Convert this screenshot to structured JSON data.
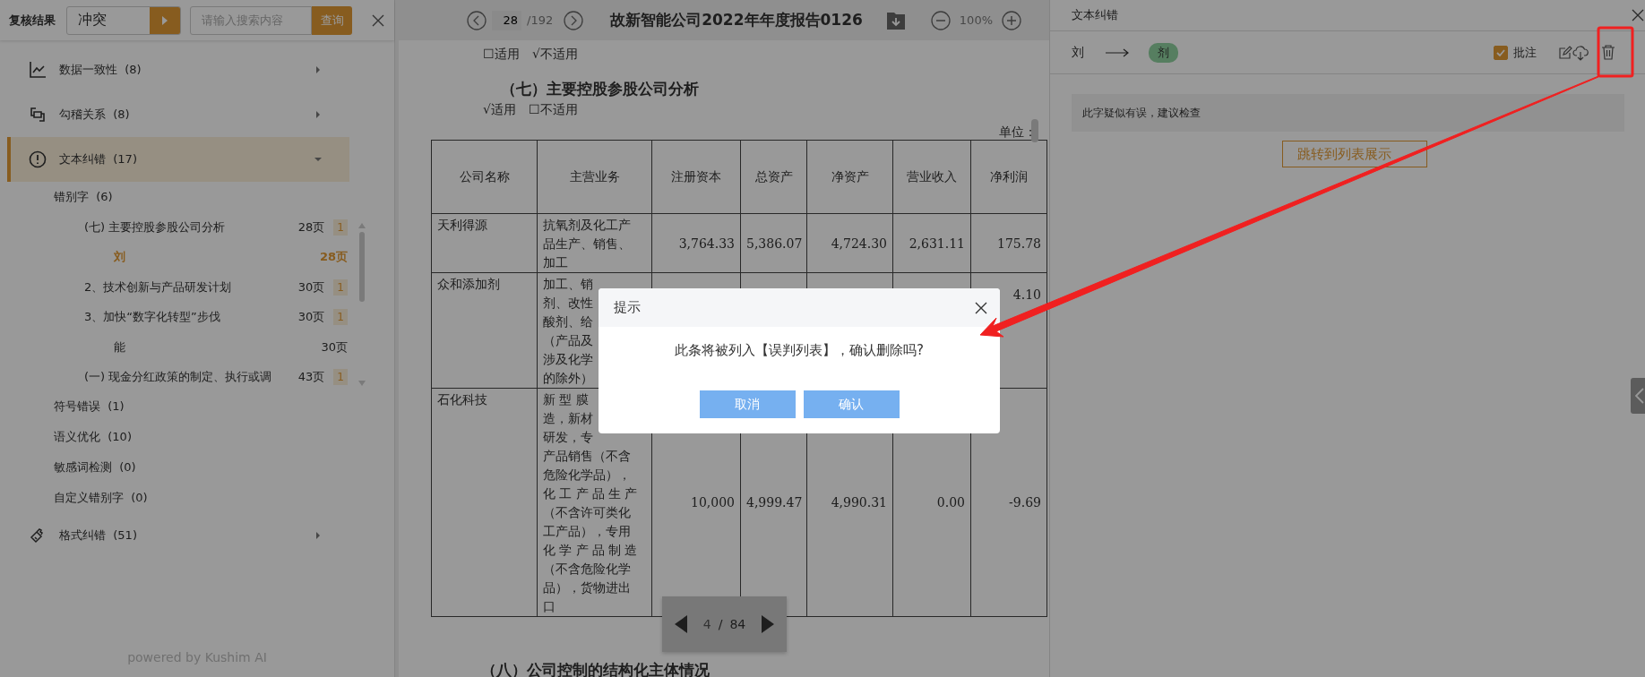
{
  "left_panel": {
    "title": "复核结果",
    "filter": {
      "value": "冲突"
    },
    "search": {
      "placeholder": "请输入搜索内容",
      "button": "查询"
    },
    "categories": [
      {
        "label": "数据一致性",
        "count": "(8)",
        "expanded": false,
        "selected": false
      },
      {
        "label": "勾稽关系",
        "count": "(8)",
        "expanded": false,
        "selected": false
      },
      {
        "label": "文本纠错",
        "count": "(17)",
        "expanded": true,
        "selected": true,
        "children": [
          {
            "label": "错别字",
            "count": "(6)",
            "entries": [
              {
                "title": "(七) 主要控股参股公司分析",
                "page": "28页",
                "badge": "1",
                "children": [
                  {
                    "title": "刘",
                    "page": "28页",
                    "selected": true
                  }
                ]
              },
              {
                "title": "2、技术创新与产品研发计划",
                "page": "30页",
                "badge": "1"
              },
              {
                "title": "3、加快“数字化转型”步伐",
                "page": "30页",
                "badge": "1",
                "children": [
                  {
                    "title": "能",
                    "page": "30页",
                    "selected": false
                  }
                ]
              },
              {
                "title": "(一) 现金分红政策的制定、执行或调",
                "page": "43页",
                "badge": "1"
              }
            ]
          },
          {
            "label": "符号错误",
            "count": "(1)"
          },
          {
            "label": "语义优化",
            "count": "(10)"
          },
          {
            "label": "敏感词检测",
            "count": "(0)"
          },
          {
            "label": "自定义错别字",
            "count": "(0)"
          }
        ]
      },
      {
        "label": "格式纠错",
        "count": "(51)",
        "expanded": false,
        "selected": false
      }
    ],
    "footer": "powered by Kushim AI"
  },
  "viewer": {
    "page": "28",
    "total": "/192",
    "title": "故新智能公司2022年年度报告0126",
    "zoom": "100%"
  },
  "document": {
    "line_1": "☐适用　√不适用",
    "heading": "（七）主要控股参股公司分析",
    "line_2": "√适用　☐不适用",
    "unit": "单位：",
    "table": {
      "columns": [
        "公司名称",
        "主营业务",
        "注册资本",
        "总资产",
        "净资产",
        "营业收入",
        "净利润"
      ],
      "rows": [
        {
          "name": "天利得源",
          "business": [
            "抗氧剂及化工产",
            "品生产、销售、",
            "加工"
          ],
          "values": [
            "3,764.33",
            "5,386.07",
            "4,724.30",
            "2,631.11",
            "175.78"
          ]
        },
        {
          "name": "众和添加剂",
          "business": [
            "加工、销",
            "剂、改性",
            "酸剂、给",
            "（产品及",
            "涉及化学",
            "的除外）"
          ],
          "values": [
            "4.10"
          ]
        },
        {
          "name": "石化科技",
          "business": [
            "新 型 膜",
            "造，新材",
            "研发，专",
            "产品销售（不含",
            "危险化学品），",
            "化 工 产 品 生 产",
            "（不含许可类化",
            "工产品），专用",
            "化 学 产 品 制 造",
            "（不含危险化学",
            "品），货物进出",
            "口"
          ],
          "values": [
            "10,000",
            "4,999.47",
            "4,990.31",
            "0.00",
            "-9.69"
          ]
        }
      ]
    },
    "heading_2": "（八）公司控制的结构化主体情况"
  },
  "pager": {
    "current": "4",
    "separator": "/",
    "total": "84"
  },
  "right_panel": {
    "title": "文本纠错",
    "original": "刘",
    "suggestion": "剂",
    "annotate": {
      "label": "批注",
      "checked": true
    },
    "message": "此字疑似有误，建议检查",
    "button": "跳转到列表展示"
  },
  "dialog": {
    "title": "提示",
    "message": "此条将被列入【误判列表】，确认删除吗?",
    "buttons": [
      "取消",
      "确认"
    ]
  }
}
